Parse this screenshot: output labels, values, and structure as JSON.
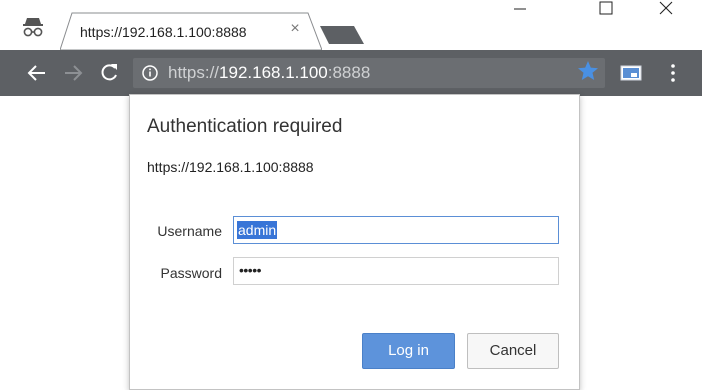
{
  "browser": {
    "tab": {
      "title": "https://192.168.1.100:8888",
      "close_glyph": "×"
    },
    "window_controls": {
      "minimize": "—",
      "maximize": "☐",
      "close": "✕"
    },
    "icons": {
      "incognito": "incognito-icon",
      "back": "back-arrow-icon",
      "forward": "forward-arrow-icon",
      "reload": "reload-icon",
      "info": "info-icon",
      "star": "star-icon",
      "cast": "cast-icon",
      "menu": "menu-icon"
    },
    "omnibox": {
      "scheme": "https://",
      "host": "192.168.1.100",
      "port": ":8888"
    },
    "colors": {
      "toolbar": "#5d6064",
      "star": "#4a90e2"
    }
  },
  "dialog": {
    "title": "Authentication required",
    "url": "https://192.168.1.100:8888",
    "username_label": "Username",
    "username_value": "admin",
    "password_label": "Password",
    "password_value": "•••••",
    "login_label": "Log in",
    "cancel_label": "Cancel",
    "colors": {
      "primary_button": "#5d93db",
      "selection": "#3875d7"
    }
  }
}
